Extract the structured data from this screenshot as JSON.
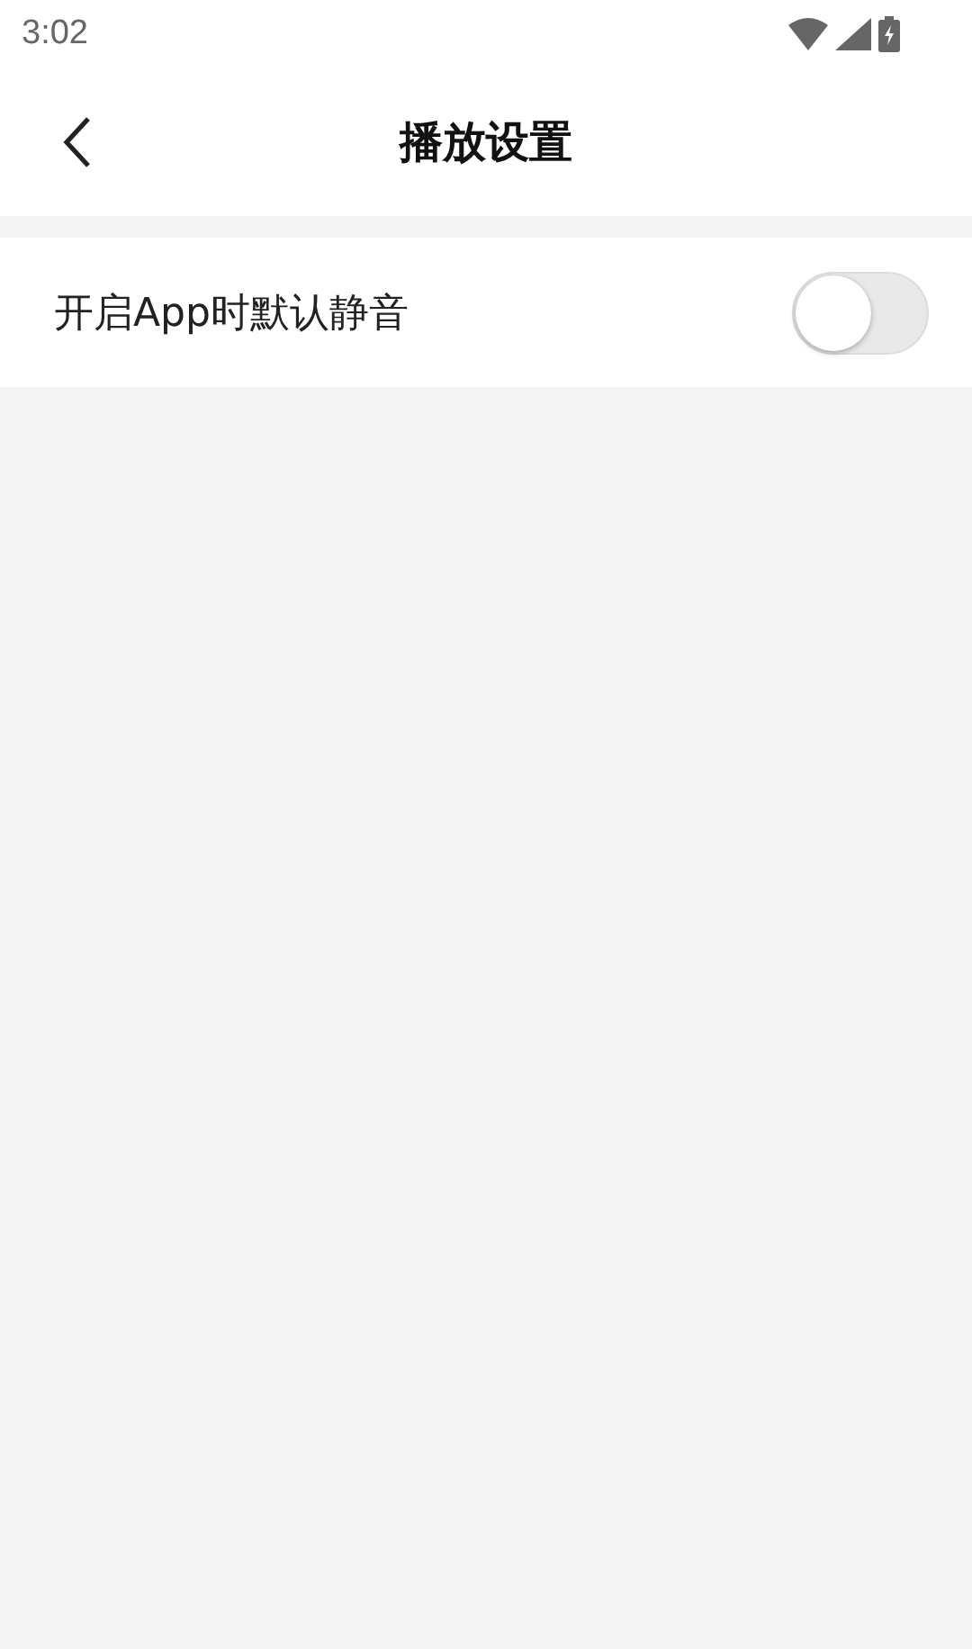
{
  "status_bar": {
    "time": "3:02"
  },
  "header": {
    "title": "播放设置"
  },
  "settings": [
    {
      "kind": "toggle",
      "label": "开启App时默认静音",
      "on": false
    }
  ]
}
